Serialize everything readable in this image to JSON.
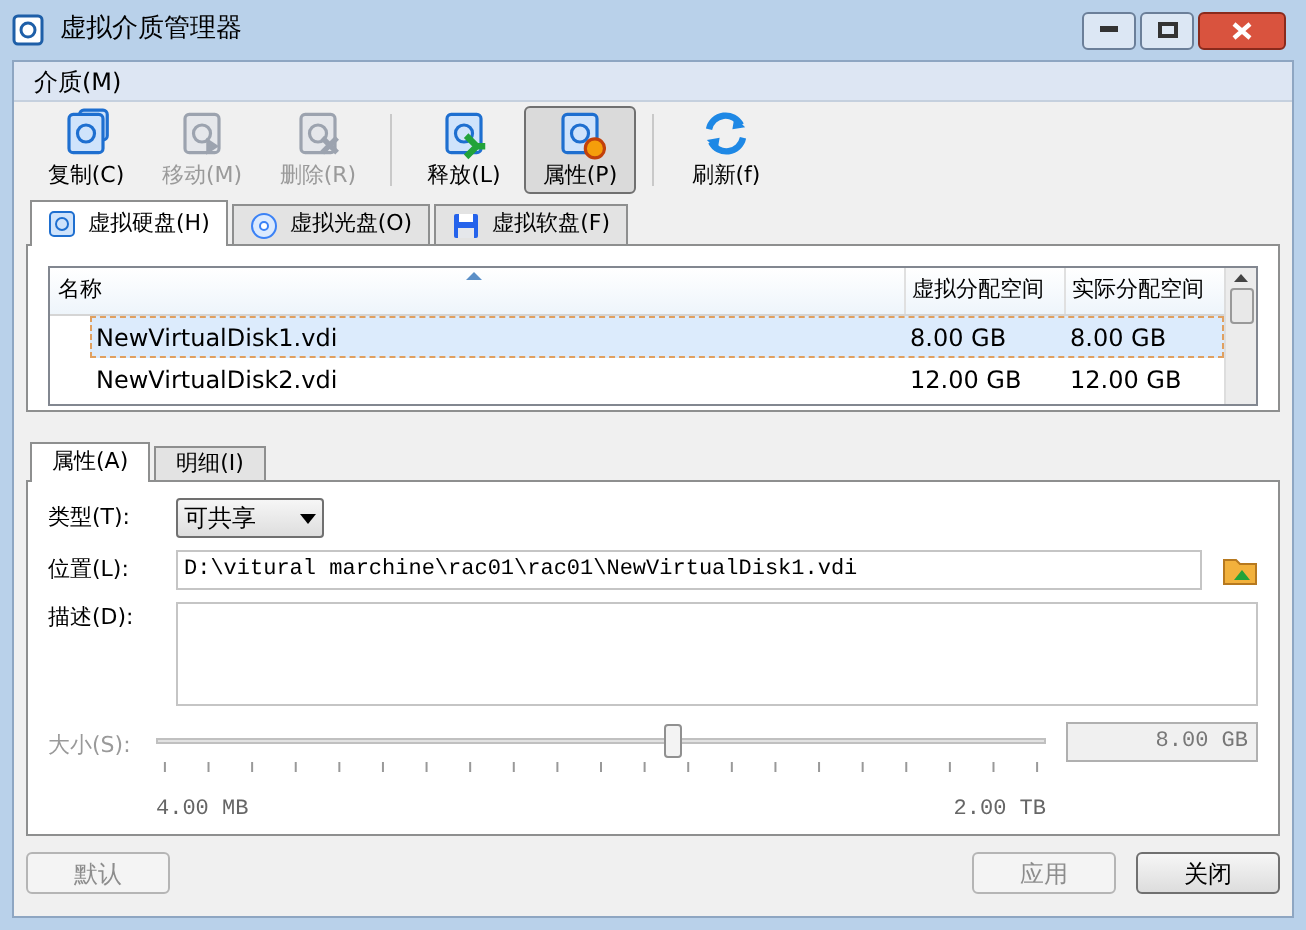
{
  "window": {
    "title": "虚拟介质管理器"
  },
  "menu": [
    "介质(M)"
  ],
  "toolbar_groups": [
    [
      {
        "label": "复制(C)",
        "kind": "copy",
        "disabled": false,
        "selected": false
      },
      {
        "label": "移动(M)",
        "kind": "move",
        "disabled": true,
        "selected": false
      },
      {
        "label": "删除(R)",
        "kind": "delete",
        "disabled": true,
        "selected": false
      }
    ],
    [
      {
        "label": "释放(L)",
        "kind": "release",
        "disabled": false,
        "selected": false
      },
      {
        "label": "属性(P)",
        "kind": "properties",
        "disabled": false,
        "selected": true
      }
    ],
    [
      {
        "label": "刷新(f)",
        "kind": "refresh",
        "disabled": false,
        "selected": false
      }
    ]
  ],
  "media_tabs": [
    {
      "label": "虚拟硬盘(H)",
      "kind": "hdd",
      "selected": true
    },
    {
      "label": "虚拟光盘(O)",
      "kind": "cd",
      "selected": false
    },
    {
      "label": "虚拟软盘(F)",
      "kind": "floppy",
      "selected": false
    }
  ],
  "table": {
    "columns": [
      "名称",
      "虚拟分配空间",
      "实际分配空间"
    ],
    "rows": [
      {
        "name": "NewVirtualDisk1.vdi",
        "virtual_size": "8.00 GB",
        "actual_size": "8.00 GB",
        "selected": true
      },
      {
        "name": "NewVirtualDisk2.vdi",
        "virtual_size": "12.00 GB",
        "actual_size": "12.00 GB",
        "selected": false
      }
    ]
  },
  "detail_tabs": [
    {
      "label": "属性(A)",
      "selected": true
    },
    {
      "label": "明细(I)",
      "selected": false
    }
  ],
  "properties": {
    "type_label": "类型(T):",
    "type_value": "可共享",
    "location_label": "位置(L):",
    "location_value": "D:\\vitural marchine\\rac01\\rac01\\NewVirtualDisk1.vdi",
    "description_label": "描述(D):",
    "size_label": "大小(S):",
    "size_slider": {
      "level": 0.58
    },
    "size_value": "8.00 GB",
    "size_min": "4.00 MB",
    "size_max": "2.00 TB",
    "size_disabled": true
  },
  "buttons": {
    "reset": {
      "label": "默认",
      "disabled": true
    },
    "apply": {
      "label": "应用",
      "disabled": true
    },
    "close": {
      "label": "关闭",
      "disabled": false
    }
  }
}
